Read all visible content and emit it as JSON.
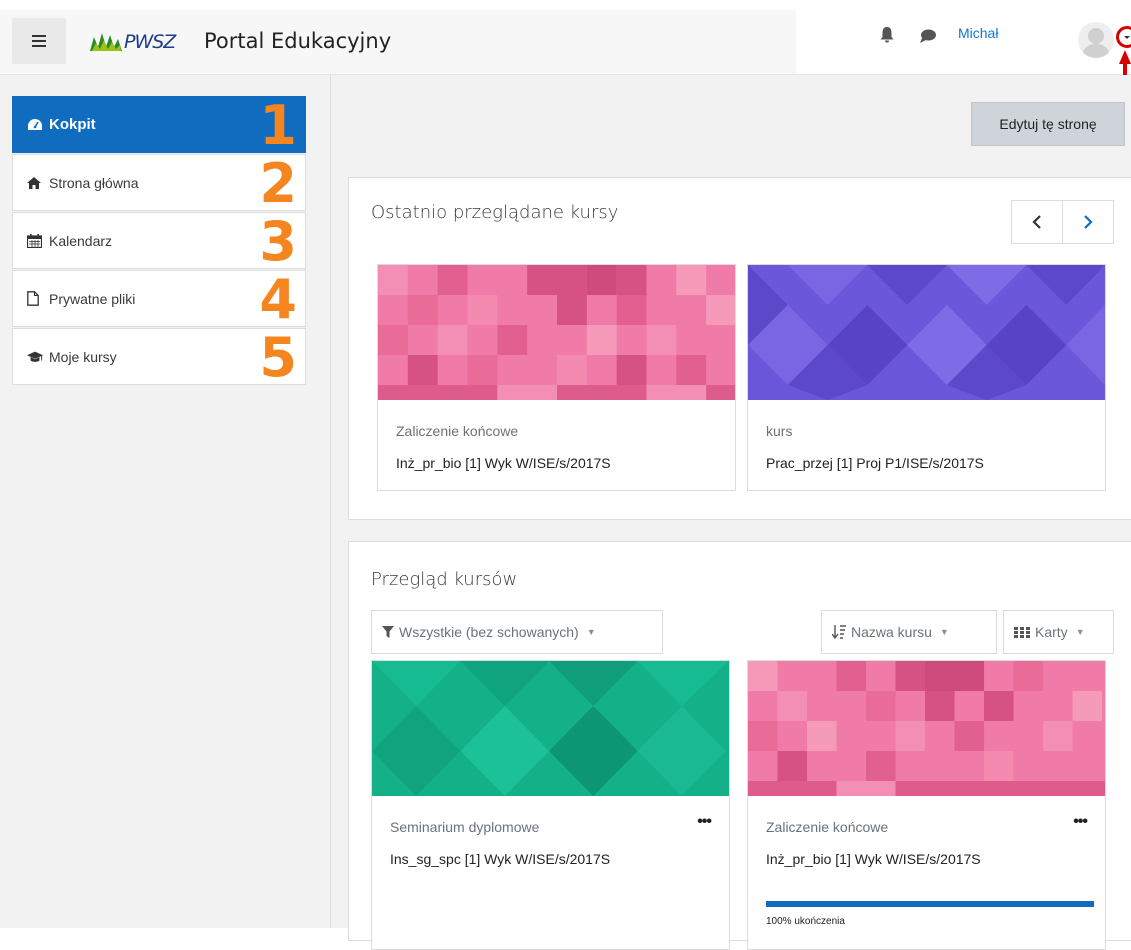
{
  "header": {
    "logo_text": "PWSZ",
    "site_name": "Portal Edukacyjny",
    "user_name": "Michał"
  },
  "nav": {
    "items": [
      {
        "label": "Kokpit",
        "icon": "dashboard-icon",
        "number": "1",
        "active": true
      },
      {
        "label": "Strona główna",
        "icon": "home-icon",
        "number": "2",
        "active": false
      },
      {
        "label": "Kalendarz",
        "icon": "calendar-icon",
        "number": "3",
        "active": false
      },
      {
        "label": "Prywatne pliki",
        "icon": "file-icon",
        "number": "4",
        "active": false
      },
      {
        "label": "Moje kursy",
        "icon": "graduation-cap-icon",
        "number": "5",
        "active": false
      }
    ]
  },
  "main": {
    "edit_button": "Edytuj tę stronę",
    "recent": {
      "title": "Ostatnio przeglądane kursy",
      "courses": [
        {
          "category": "Zaliczenie końcowe",
          "name": "Inż_pr_bio [1] Wyk W/ISE/s/2017S",
          "color": "#f07aa8"
        },
        {
          "category": "kurs",
          "name": "Prac_przej [1] Proj P1/ISE/s/2017S",
          "color": "#6b57d9"
        }
      ]
    },
    "overview": {
      "title": "Przegląd kursów",
      "filter_label": "Wszystkie (bez schowanych)",
      "sort_label": "Nazwa kursu",
      "view_label": "Karty",
      "courses": [
        {
          "category": "Seminarium dyplomowe",
          "name": "Ins_sg_spc [1] Wyk W/ISE/s/2017S",
          "color": "#14b088"
        },
        {
          "category": "Zaliczenie końcowe",
          "name": "Inż_pr_bio [1] Wyk W/ISE/s/2017S",
          "color": "#f07aa8",
          "progress": 100,
          "progress_text": "100% ukończenia"
        }
      ]
    }
  },
  "colors": {
    "accent": "#0f6cbf",
    "number_orange": "#f5861f",
    "annotation_red": "#d60000"
  }
}
